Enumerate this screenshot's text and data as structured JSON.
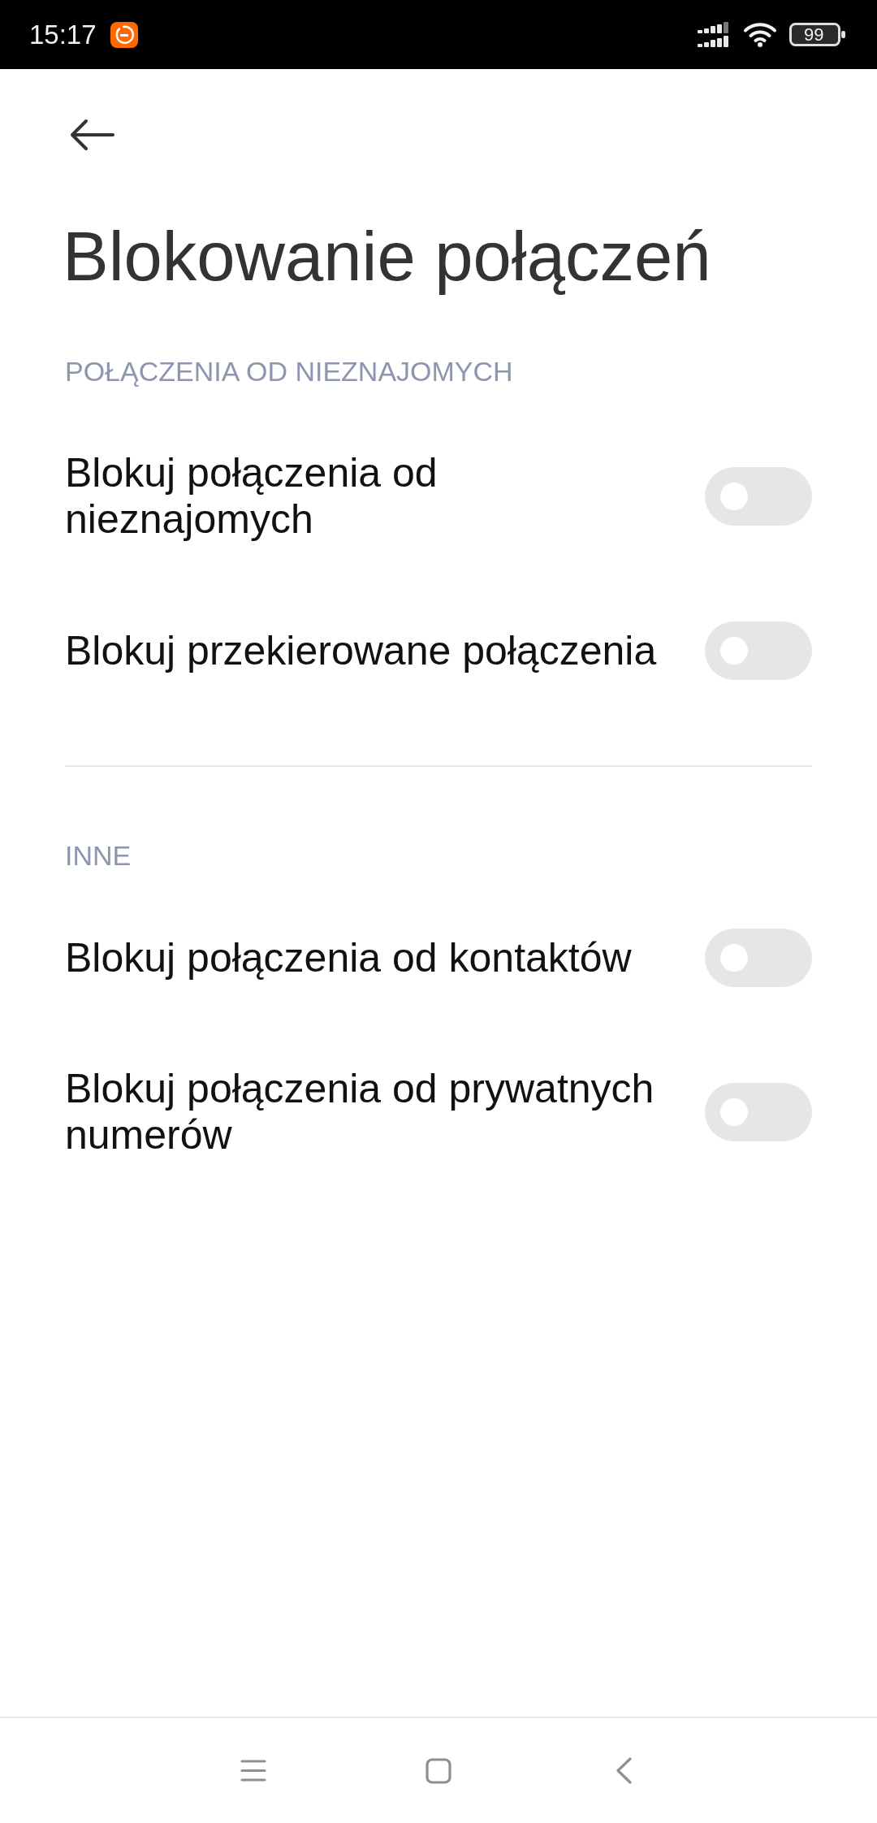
{
  "status_bar": {
    "time": "15:17",
    "battery": "99"
  },
  "header": {
    "title": "Blokowanie połączeń"
  },
  "sections": [
    {
      "title": "POŁĄCZENIA OD NIEZNAJOMYCH",
      "items": [
        {
          "label": "Blokuj połączenia od nieznajomych",
          "on": false
        },
        {
          "label": "Blokuj przekierowane połączenia",
          "on": false
        }
      ]
    },
    {
      "title": "INNE",
      "items": [
        {
          "label": "Blokuj połączenia od kontaktów",
          "on": false
        },
        {
          "label": "Blokuj połączenia od prywatnych numerów",
          "on": false
        }
      ]
    }
  ]
}
